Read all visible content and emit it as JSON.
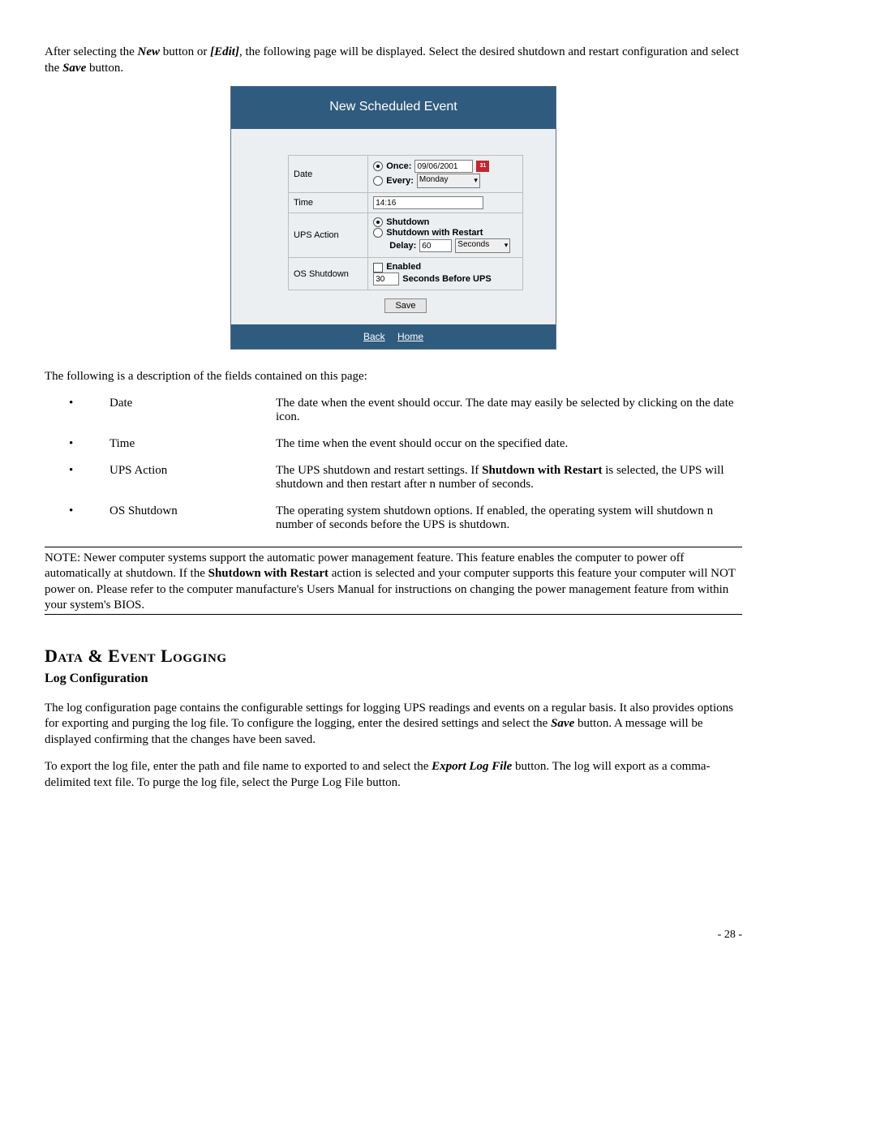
{
  "intro": {
    "prefix": "After selecting the ",
    "new": "New",
    "mid1": " button or ",
    "edit": "[Edit]",
    "mid2": ", the following page will be displayed.  Select the desired shutdown and restart configuration and select the ",
    "save": "Save",
    "suffix": " button."
  },
  "app": {
    "title": "New Scheduled Event",
    "rows": {
      "date": {
        "label": "Date",
        "once_label": "Once:",
        "once_value": "09/06/2001",
        "every_label": "Every:",
        "every_value": "Monday"
      },
      "time": {
        "label": "Time",
        "value": "14:16"
      },
      "ups": {
        "label": "UPS Action",
        "shutdown": "Shutdown",
        "shutdown_restart": "Shutdown with Restart",
        "delay_label": "Delay:",
        "delay_value": "60",
        "delay_unit": "Seconds"
      },
      "os": {
        "label": "OS Shutdown",
        "enabled": "Enabled",
        "seconds_value": "30",
        "seconds_label": "Seconds Before UPS"
      }
    },
    "save": "Save",
    "footer": {
      "back": "Back",
      "home": "Home"
    }
  },
  "desc_intro": "The following is a description of the fields contained on this page:",
  "desc": [
    {
      "term": "Date",
      "text": "The date when the event should occur.  The date may easily be selected by clicking on the date icon."
    },
    {
      "term": "Time",
      "text": "The time when the event should occur on the specified date."
    },
    {
      "term": "UPS Action",
      "text_pre": "The UPS shutdown and restart settings.  If ",
      "bold": "Shutdown with Restart",
      "text_post": " is selected, the UPS will shutdown and then restart after n number of seconds."
    },
    {
      "term": "OS Shutdown",
      "text": "The operating system shutdown options.  If enabled, the operating system will shutdown n number of seconds before the UPS is shutdown."
    }
  ],
  "note": {
    "pre": "NOTE: Newer computer systems support the automatic power management feature. This feature enables the computer to power off automatically at shutdown. If the ",
    "bold": "Shutdown with Restart",
    "post": " action is selected and your computer supports this feature your computer will NOT power on. Please refer to the computer manufacture's Users Manual for instructions on changing the power management feature from within your system's BIOS."
  },
  "section_heading": "Data & Event Logging",
  "sub_heading": "Log Configuration",
  "log_p1": {
    "pre": "The log configuration page contains the configurable settings for logging UPS readings and events on a regular basis.  It also provides options for exporting and purging the log file. To configure the logging, enter the desired settings and select the ",
    "bold": "Save",
    "post": " button.  A message will be displayed confirming that the changes have been saved."
  },
  "log_p2": {
    "pre": "To export the log file, enter the path and file name to exported to and select the ",
    "bold": "Export Log File",
    "post": " button. The log will export as a comma-delimited text file. To purge the log file, select the Purge Log File button."
  },
  "page_number": "- 28 -"
}
